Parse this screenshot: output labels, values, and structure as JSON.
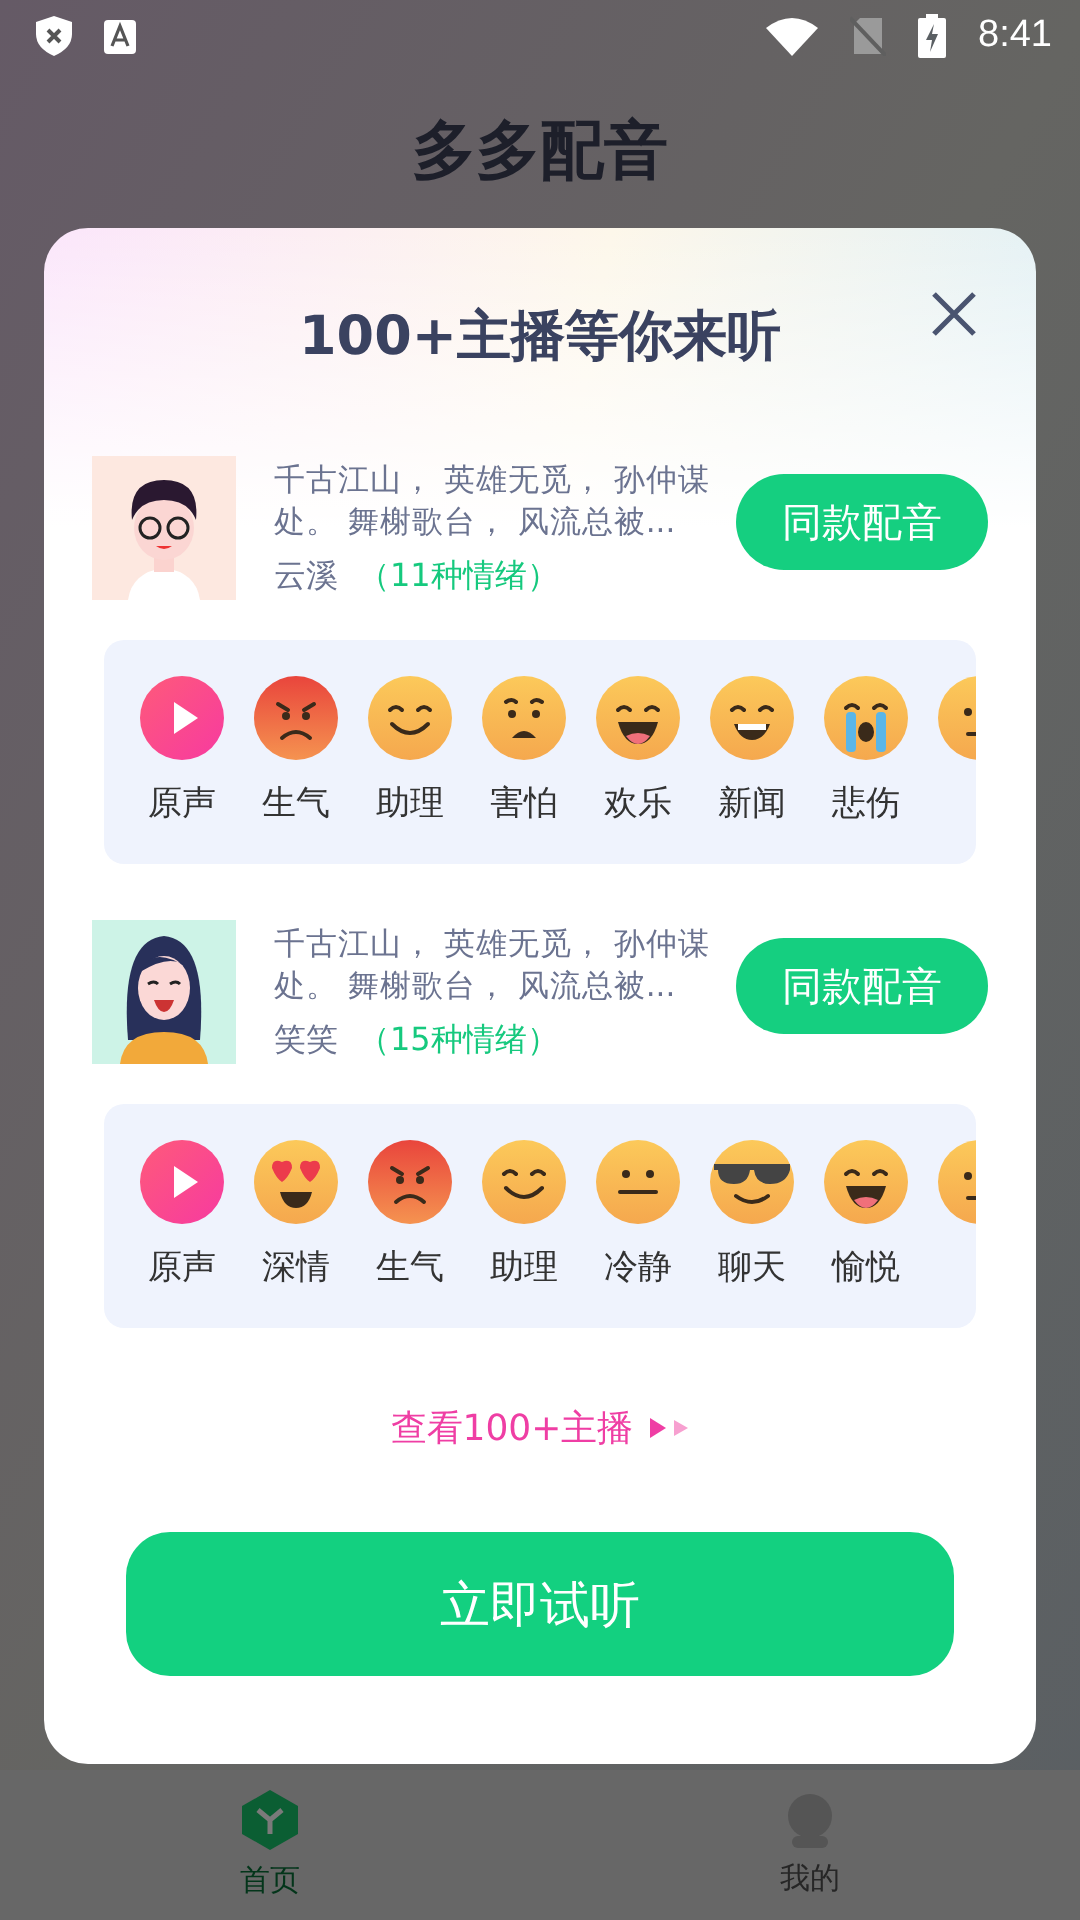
{
  "status_bar": {
    "time": "8:41"
  },
  "app_title": "多多配音",
  "dialog": {
    "title": "100+主播等你来听",
    "voices": [
      {
        "avatar": {
          "kind": "boy"
        },
        "description": "千古江山， 英雄无觅， 孙仲谋处。 舞榭歌台， 风流总被...",
        "name": "云溪",
        "emotion_count": "（11种情绪）",
        "button": "同款配音",
        "emotions": [
          {
            "kind": "play",
            "label": "原声"
          },
          {
            "kind": "angry",
            "label": "生气"
          },
          {
            "kind": "smile",
            "label": "助理"
          },
          {
            "kind": "scared",
            "label": "害怕"
          },
          {
            "kind": "laugh",
            "label": "欢乐"
          },
          {
            "kind": "grin",
            "label": "新闻"
          },
          {
            "kind": "cry",
            "label": "悲伤"
          },
          {
            "kind": "stern"
          }
        ]
      },
      {
        "avatar": {
          "kind": "girl"
        },
        "description": "千古江山， 英雄无觅， 孙仲谋处。 舞榭歌台， 风流总被...",
        "name": "笑笑",
        "emotion_count": "（15种情绪）",
        "button": "同款配音",
        "emotions": [
          {
            "kind": "play",
            "label": "原声"
          },
          {
            "kind": "love",
            "label": "深情"
          },
          {
            "kind": "angry",
            "label": "生气"
          },
          {
            "kind": "smile",
            "label": "助理"
          },
          {
            "kind": "neutral",
            "label": "冷静"
          },
          {
            "kind": "cool",
            "label": "聊天"
          },
          {
            "kind": "laugh",
            "label": "愉悦"
          },
          {
            "kind": "stern"
          }
        ]
      }
    ],
    "more_link": "查看100+主播",
    "primary_button": "立即试听"
  },
  "bottom_nav": [
    {
      "label": "首页",
      "selected": true
    },
    {
      "label": "我的",
      "selected": false
    }
  ]
}
